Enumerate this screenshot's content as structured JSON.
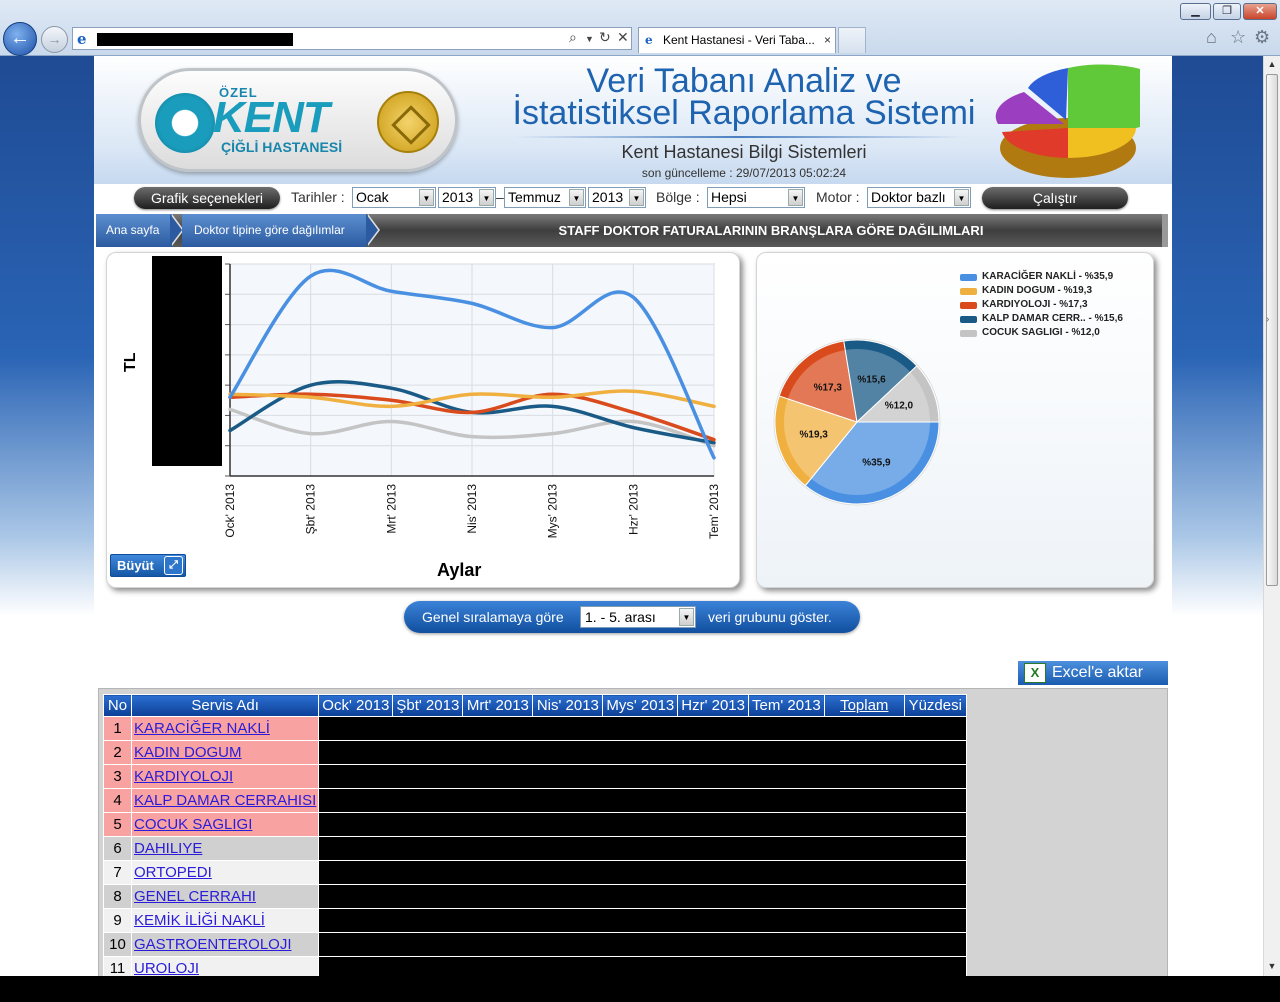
{
  "browser": {
    "tab_title": "Kent Hastanesi - Veri Taba...",
    "tab_close": "×",
    "window_buttons": [
      "minimize-icon",
      "restore-icon",
      "close-icon"
    ],
    "toolbar_icons": [
      "home-icon",
      "star-icon",
      "gear-icon"
    ]
  },
  "header": {
    "logo_ozel": "ÖZEL",
    "logo_kent": "KENT",
    "logo_cigli": "ÇİĞLİ HASTANESİ",
    "title_line1": "Veri Tabanı Analiz ve",
    "title_line2": "İstatistiksel Raporlama Sistemi",
    "subtitle": "Kent Hastanesi Bilgi Sistemleri",
    "updated": "son güncelleme : 29/07/2013 05:02:24"
  },
  "toolbar": {
    "chart_options": "Grafik seçenekleri",
    "dates_label": "Tarihler :",
    "start_month": "Ocak",
    "start_year": "2013",
    "dash": "–",
    "end_month": "Temmuz",
    "end_year": "2013",
    "region_label": "Bölge :",
    "region": "Hepsi",
    "engine_label": "Motor :",
    "engine": "Doktor bazlı",
    "run": "Çalıştır"
  },
  "breadcrumb": {
    "home": "Ana sayfa",
    "current": "Doktor tipine göre dağılımlar",
    "report_title": "STAFF DOKTOR FATURALARININ BRANŞLARA GÖRE DAĞILIMLARI"
  },
  "line_chart": {
    "ylabel": "TL",
    "xlabel": "Aylar",
    "enlarge": "Büyüt"
  },
  "chart_data": [
    {
      "type": "line",
      "xlabel": "Aylar",
      "ylabel": "TL",
      "categories": [
        "Ock' 2013",
        "Şbt' 2013",
        "Mrt' 2013",
        "Nis' 2013",
        "Mys' 2013",
        "Hzr' 2013",
        "Tem' 2013"
      ],
      "ylim": [
        0,
        7
      ],
      "grid": true,
      "series": [
        {
          "name": "KARACİĞER NAKLİ",
          "color": "#4a90e2",
          "values": [
            2.6,
            6.6,
            6.1,
            5.7,
            4.9,
            5.9,
            0.6
          ]
        },
        {
          "name": "KADIN DOGUM",
          "color": "#f0b040",
          "values": [
            2.7,
            2.6,
            2.3,
            2.7,
            2.6,
            2.8,
            2.3
          ]
        },
        {
          "name": "KARDIYOLOJI",
          "color": "#d94b1c",
          "values": [
            2.6,
            2.7,
            2.5,
            2.1,
            2.7,
            2.1,
            1.2
          ]
        },
        {
          "name": "KALP DAMAR CERRAHISI",
          "color": "#1a5a86",
          "values": [
            1.5,
            3.0,
            2.9,
            2.1,
            2.3,
            1.6,
            1.1
          ]
        },
        {
          "name": "COCUK SAGLIGI",
          "color": "#c4c4c4",
          "values": [
            2.2,
            1.4,
            1.8,
            1.3,
            1.4,
            1.8,
            1.0
          ]
        }
      ]
    },
    {
      "type": "pie",
      "legend_position": "top-right",
      "legend": [
        "KARACİĞER NAKLİ - %35,9",
        "KADIN DOGUM - %19,3",
        "KARDIYOLOJI - %17,3",
        "KALP DAMAR CERR.. - %15,6",
        "COCUK SAGLIGI - %12,0"
      ],
      "slices": [
        {
          "label": "%35,9",
          "value": 35.9,
          "color": "#4a90e2"
        },
        {
          "label": "%19,3",
          "value": 19.3,
          "color": "#f0b040"
        },
        {
          "label": "%17,3",
          "value": 17.3,
          "color": "#d94b1c"
        },
        {
          "label": "%15,6",
          "value": 15.6,
          "color": "#1a5a86"
        },
        {
          "label": "%12,0",
          "value": 12.0,
          "color": "#c4c4c4"
        }
      ]
    }
  ],
  "group_bar": {
    "prefix": "Genel sıralamaya göre",
    "selected": "1. - 5. arası",
    "suffix": "veri grubunu göster."
  },
  "export": {
    "label": "Excel'e aktar"
  },
  "table": {
    "headers": [
      "No",
      "Servis Adı",
      "Ock' 2013",
      "Şbt' 2013",
      "Mrt' 2013",
      "Nis' 2013",
      "Mys' 2013",
      "Hzr' 2013",
      "Tem' 2013",
      "Toplam",
      "Yüzdesi"
    ],
    "rows": [
      {
        "no": "1",
        "name": "KARACİĞER NAKLİ"
      },
      {
        "no": "2",
        "name": "KADIN DOGUM"
      },
      {
        "no": "3",
        "name": "KARDIYOLOJI"
      },
      {
        "no": "4",
        "name": "KALP DAMAR CERRAHISI"
      },
      {
        "no": "5",
        "name": "COCUK SAGLIGI"
      },
      {
        "no": "6",
        "name": "DAHILIYE"
      },
      {
        "no": "7",
        "name": "ORTOPEDI"
      },
      {
        "no": "8",
        "name": "GENEL CERRAHI"
      },
      {
        "no": "9",
        "name": "KEMİK İLİĞİ NAKLİ"
      },
      {
        "no": "10",
        "name": "GASTROENTEROLOJI"
      },
      {
        "no": "11",
        "name": "UROLOJI"
      }
    ]
  }
}
